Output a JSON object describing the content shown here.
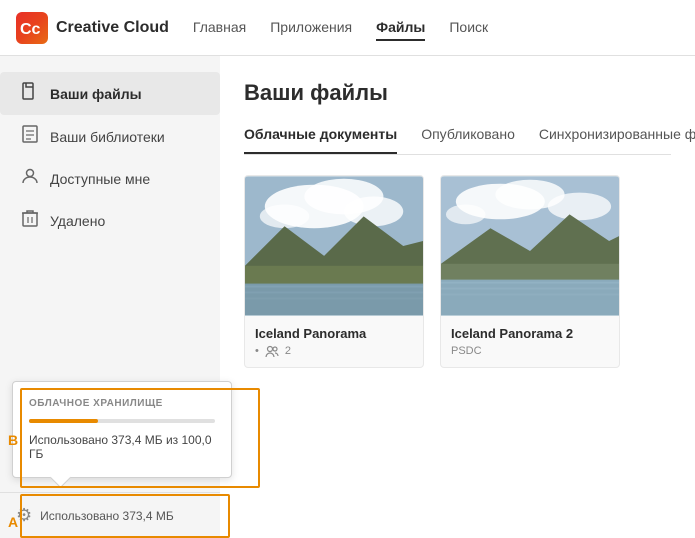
{
  "header": {
    "title": "Creative Cloud",
    "nav": [
      {
        "id": "home",
        "label": "Главная",
        "active": false
      },
      {
        "id": "apps",
        "label": "Приложения",
        "active": false
      },
      {
        "id": "files",
        "label": "Файлы",
        "active": true
      },
      {
        "id": "search",
        "label": "Поиск",
        "active": false
      }
    ]
  },
  "sidebar": {
    "items": [
      {
        "id": "your-files",
        "label": "Ваши файлы",
        "icon": "📄",
        "active": true
      },
      {
        "id": "your-libraries",
        "label": "Ваши библиотеки",
        "icon": "📚",
        "active": false
      },
      {
        "id": "shared",
        "label": "Доступные мне",
        "icon": "👤",
        "active": false
      },
      {
        "id": "deleted",
        "label": "Удалено",
        "icon": "🗑",
        "active": false
      }
    ],
    "storage": {
      "gear_icon": "⚙",
      "usage_label": "Использовано 373,4 МБ"
    },
    "popup": {
      "title": "ОБЛАЧНОЕ ХРАНИЛИЩЕ",
      "usage_detail": "Использовано 373,4 МБ из 100,0 ГБ",
      "used_percent": 0.37
    }
  },
  "content": {
    "title": "Ваши файлы",
    "tabs": [
      {
        "id": "cloud-docs",
        "label": "Облачные документы",
        "active": true
      },
      {
        "id": "published",
        "label": "Опубликовано",
        "active": false
      },
      {
        "id": "synced",
        "label": "Синхронизированные ф",
        "active": false
      }
    ],
    "files": [
      {
        "id": "iceland-1",
        "name": "Iceland Panorama",
        "meta_type": "• 👥 2",
        "thumb_colors": {
          "sky": "#87a8c8",
          "land": "#5a6e3a",
          "water": "#7a9aaa"
        }
      },
      {
        "id": "iceland-2",
        "name": "Iceland Panorama 2",
        "meta_type": "PSDC",
        "thumb_colors": {
          "sky": "#9ab5cc",
          "land": "#6a7c50",
          "water": "#8aaabb"
        }
      }
    ]
  },
  "labels": {
    "b": "B",
    "a": "A"
  }
}
